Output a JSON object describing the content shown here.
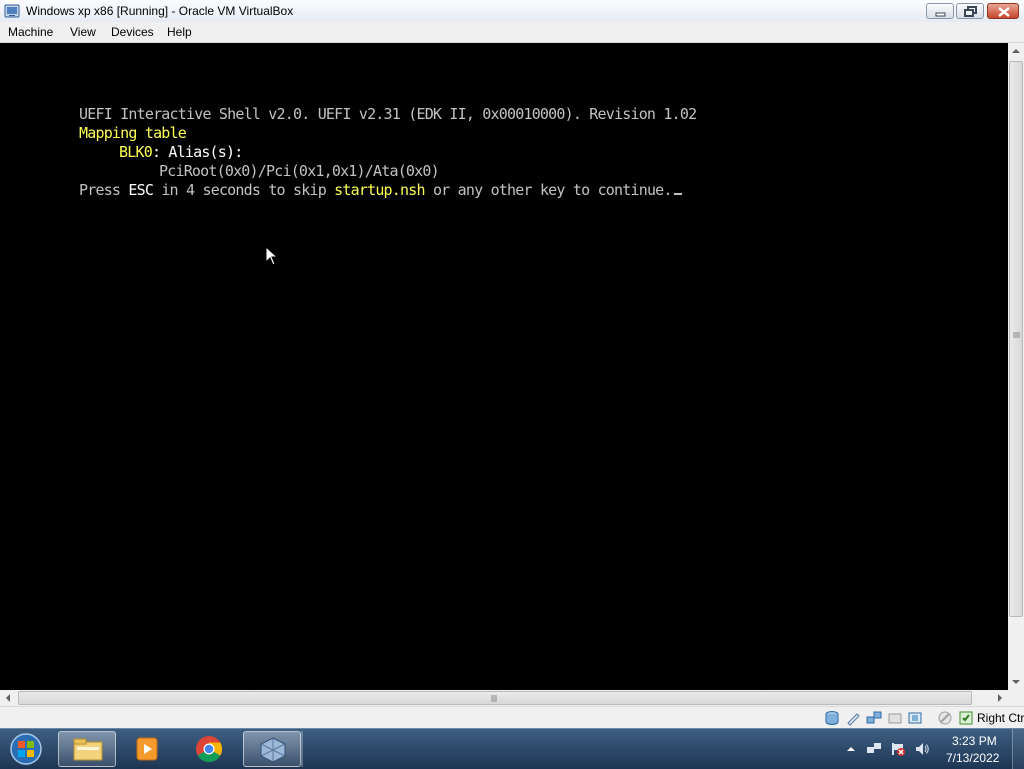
{
  "window": {
    "title": "Windows xp x86 [Running] - Oracle VM VirtualBox",
    "icon": "virtualbox-icon",
    "controls": [
      "minimize-icon",
      "maximize-icon",
      "close-icon"
    ]
  },
  "menu": {
    "machine": "Machine",
    "view": "View",
    "devices": "Devices",
    "help": "Help"
  },
  "console": {
    "line1": "UEFI Interactive Shell v2.0. UEFI v2.31 (EDK II, 0x00010000). Revision 1.02",
    "line2": "Mapping table",
    "line3_device": "BLK0",
    "line3_rest": ": Alias(s):",
    "line4": "PciRoot(0x0)/Pci(0x1,0x1)/Ata(0x0)",
    "line5_a": "Press ",
    "line5_esc": "ESC",
    "line5_b": " in 4 seconds to skip ",
    "line5_file": "startup.nsh",
    "line5_c": " or any other key to continue.",
    "colors": {
      "text": "#c2c2c2",
      "highlight": "#ffff55",
      "bright": "#ffffff",
      "background": "#000000"
    }
  },
  "statusbar": {
    "icons": [
      "hard-disk-icon",
      "optical-drive-icon",
      "network-icon",
      "usb-icon",
      "shared-folder-icon",
      "display-icon",
      "capture-icon",
      "mouse-integration-icon"
    ],
    "host_key": "Right Ctrl"
  },
  "taskbar": {
    "start": "start-orb-icon",
    "apps": [
      "windows-explorer-icon",
      "media-player-icon",
      "chrome-icon",
      "virtualbox-icon"
    ],
    "active_app": "virtualbox-icon",
    "tray_icons": [
      "show-hidden-icons-icon",
      "network-tray-icon",
      "action-center-icon",
      "volume-icon"
    ],
    "time": "3:23 PM",
    "date": "7/13/2022"
  }
}
